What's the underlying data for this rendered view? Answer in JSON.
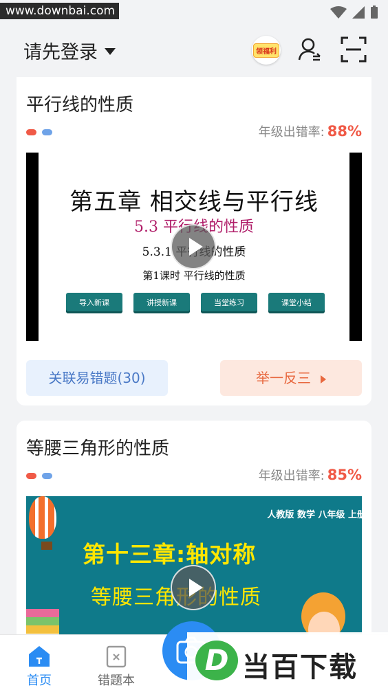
{
  "status": {
    "watermark": "www.downbai.com"
  },
  "header": {
    "login_label": "请先登录",
    "welfare_label": "领福利"
  },
  "cards": [
    {
      "title": "平行线的性质",
      "rate_label": "年级出错率:",
      "rate_value": "88%",
      "video": {
        "chapter": "第五章 相交线与平行线",
        "section": "5.3 平行线的性质",
        "subsection": "5.3.1 平行线的性质",
        "lesson": "第1课时 平行线的性质",
        "steps": [
          "导入新课",
          "讲授新课",
          "当堂练习",
          "课堂小结"
        ]
      },
      "related_btn": "关联易错题(30)",
      "similar_btn": "举一反三"
    },
    {
      "title": "等腰三角形的性质",
      "rate_label": "年级出错率:",
      "rate_value": "85%",
      "video": {
        "publisher": "人教版 数学 八年级 上册",
        "chapter": "第十三章:轴对称",
        "title": "等腰三角形的性质"
      }
    }
  ],
  "tabbar": {
    "home": "首页",
    "wrong_book": "错题本"
  },
  "watermark_logo": {
    "letter": "D",
    "text": "当百下载"
  },
  "colors": {
    "accent": "#2b8cf3",
    "rate": "#f05a47",
    "dot_red": "#f05a47",
    "dot_blue": "#6fa3e8"
  }
}
